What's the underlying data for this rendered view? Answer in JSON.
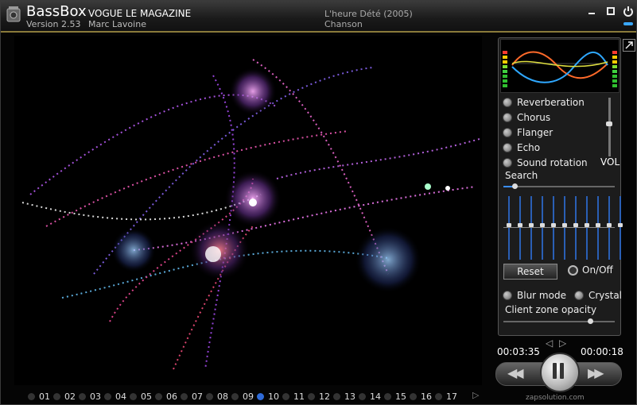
{
  "titlebar": {
    "app_name": "BassBox",
    "app_version": "Version 2.53",
    "song_title": "VOGUE LE MAGAZINE",
    "artist": "Marc Lavoine",
    "album": "L'heure Dété (2005)",
    "genre": "Chanson",
    "minimize_icon": "minimize-icon",
    "maximize_icon": "maximize-icon",
    "power_icon": "power-icon"
  },
  "effects": [
    "Reverberation",
    "Chorus",
    "Flanger",
    "Echo",
    "Sound rotation"
  ],
  "volume": {
    "label": "VOL",
    "level": 0.55
  },
  "search": {
    "label": "Search",
    "position": 0.1
  },
  "equalizer": {
    "bands": [
      0.45,
      0.45,
      0.45,
      0.45,
      0.45,
      0.45,
      0.45,
      0.45,
      0.45,
      0.45,
      0.45
    ]
  },
  "reset_label": "Reset",
  "onoff_label": "On/Off",
  "options": [
    "Blur mode",
    "Crystal"
  ],
  "opacity": {
    "label": "Client zone opacity",
    "level": 0.78
  },
  "transport": {
    "elapsed": "00:03:35",
    "remaining": "00:00:18",
    "prev_glyph": "◁",
    "next_glyph": "▷",
    "rewind_glyph": "◀◀",
    "forward_glyph": "▶▶"
  },
  "watermark": "zapsolution.com",
  "playlist": {
    "tracks": [
      "01",
      "02",
      "03",
      "04",
      "05",
      "06",
      "07",
      "08",
      "09",
      "10",
      "11",
      "12",
      "13",
      "14",
      "15",
      "16",
      "17"
    ],
    "active": "10",
    "next_glyph": "▷"
  },
  "colors": {
    "accent": "#2f6bd8",
    "title_border": "#8a7a3a",
    "eq_track": "#2a5fb5"
  }
}
